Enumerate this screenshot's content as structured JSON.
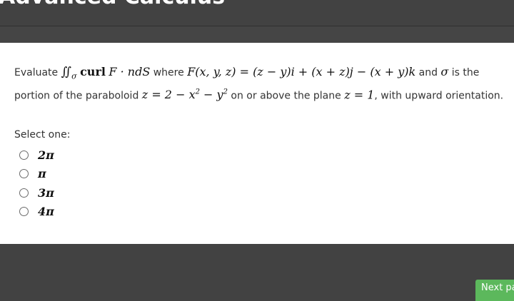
{
  "header": {
    "course_title": "Advanced Calculus"
  },
  "question": {
    "word_evaluate": "Evaluate",
    "integral_symbol": "∬",
    "integral_sub": "σ",
    "integrand_curl": "curl",
    "integrand_rest": "F · ndS",
    "word_where": "where",
    "field_lhs": "F(x, y, z) = ",
    "field_rhs": "(z − y)i + (x + z)j − (x + y)k",
    "word_and": "and",
    "sigma": "σ",
    "text_is_portion": "is the portion of the paraboloid",
    "paraboloid_eq": "z = 2 − x",
    "paraboloid_exp1": "2",
    "paraboloid_minus": " − y",
    "paraboloid_exp2": "2",
    "text_on_above": "on or above the plane",
    "plane_eq": "z = 1",
    "text_orientation": ", with upward orientation."
  },
  "select_label": "Select one:",
  "options": [
    {
      "label": "2π"
    },
    {
      "label": "π"
    },
    {
      "label": "3π"
    },
    {
      "label": "4π"
    }
  ],
  "footer": {
    "next_label": "Next page"
  },
  "colors": {
    "background": "#424242",
    "card": "#ffffff",
    "next_button": "#5cb85c"
  }
}
